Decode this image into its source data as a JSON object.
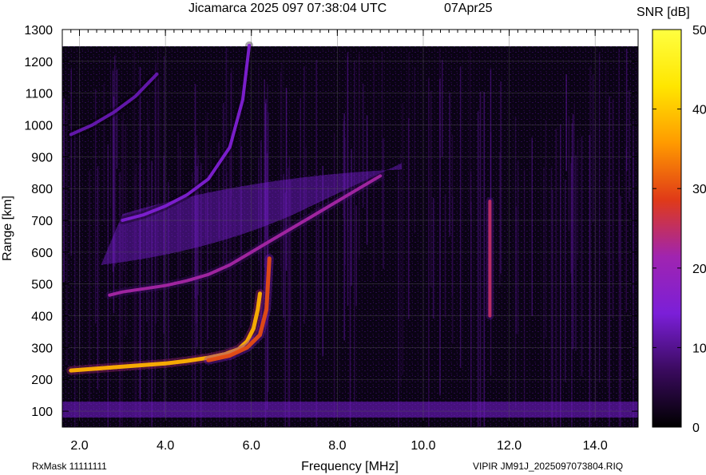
{
  "header": {
    "title": "Jicamarca 2025 097 07:38:04 UTC",
    "date": "07Apr25"
  },
  "footer": {
    "rxmask": "RxMask 11111111",
    "file": "VIPIR  JM91J_2025097073804.RIQ"
  },
  "chart_data": {
    "type": "heatmap",
    "title": "Jicamarca 2025 097 07:38:04 UTC",
    "xlabel": "Frequency [MHz]",
    "ylabel": "Range [km]",
    "xlim": [
      1.6,
      15.0
    ],
    "ylim": [
      50,
      1300
    ],
    "x_ticks": [
      2.0,
      4.0,
      6.0,
      8.0,
      10.0,
      12.0,
      14.0
    ],
    "x_tick_labels": [
      "2.0",
      "4.0",
      "6.0",
      "8.0",
      "10.0",
      "12.0",
      "14.0"
    ],
    "y_ticks": [
      100,
      200,
      300,
      400,
      500,
      600,
      700,
      800,
      900,
      1000,
      1100,
      1200,
      1300
    ],
    "y_tick_labels": [
      "100",
      "200",
      "300",
      "400",
      "500",
      "600",
      "700",
      "800",
      "900",
      "1000",
      "1100",
      "1200",
      "1300"
    ],
    "grid": true,
    "colorbar": {
      "label": "SNR [dB]",
      "range": [
        0,
        50
      ],
      "ticks": [
        0,
        10,
        20,
        30,
        40,
        50
      ],
      "colormap": [
        "#000000",
        "#3a0a5e",
        "#7b1fd8",
        "#a024b0",
        "#e03a18",
        "#ff9a00",
        "#ffe600",
        "#ffff40"
      ]
    },
    "traces": [
      {
        "name": "F-layer O-mode trace",
        "x": [
          1.8,
          2.2,
          2.6,
          3.0,
          3.5,
          4.0,
          4.5,
          5.0,
          5.4,
          5.7,
          5.9,
          6.05,
          6.15,
          6.2
        ],
        "y": [
          228,
          232,
          236,
          240,
          245,
          250,
          258,
          268,
          280,
          295,
          320,
          360,
          420,
          470
        ],
        "snr": 38
      },
      {
        "name": "F-layer X-mode trace",
        "x": [
          5.0,
          5.5,
          5.9,
          6.2,
          6.35,
          6.42
        ],
        "y": [
          260,
          275,
          300,
          340,
          420,
          580
        ],
        "snr": 30
      },
      {
        "name": "Second-hop trace",
        "x": [
          2.7,
          3.0,
          3.5,
          4.0,
          4.5,
          5.0,
          5.5,
          6.0,
          6.5,
          7.0,
          7.5,
          8.0,
          8.5,
          9.0
        ],
        "y": [
          465,
          475,
          485,
          495,
          510,
          530,
          560,
          600,
          640,
          680,
          720,
          760,
          800,
          840
        ],
        "snr": 22
      },
      {
        "name": "Third-hop trace",
        "x": [
          3.0,
          3.5,
          4.0,
          4.5,
          5.0,
          5.5,
          5.8,
          5.95
        ],
        "y": [
          700,
          718,
          745,
          780,
          830,
          930,
          1080,
          1250
        ],
        "snr": 15
      },
      {
        "name": "Upper echo arc",
        "x": [
          1.8,
          2.3,
          2.8,
          3.3,
          3.8
        ],
        "y": [
          970,
          1000,
          1040,
          1090,
          1160
        ],
        "snr": 12
      },
      {
        "name": "Interference line",
        "x": [
          11.55,
          11.55
        ],
        "y": [
          400,
          760
        ],
        "snr": 25
      }
    ],
    "regions": [
      {
        "name": "E-layer band",
        "x": [
          1.6,
          15.0
        ],
        "y": [
          80,
          130
        ],
        "snr": 14
      },
      {
        "name": "Sporadic cloud",
        "x": [
          2.5,
          9.5
        ],
        "y": [
          550,
          880
        ],
        "snr": 14
      }
    ]
  }
}
